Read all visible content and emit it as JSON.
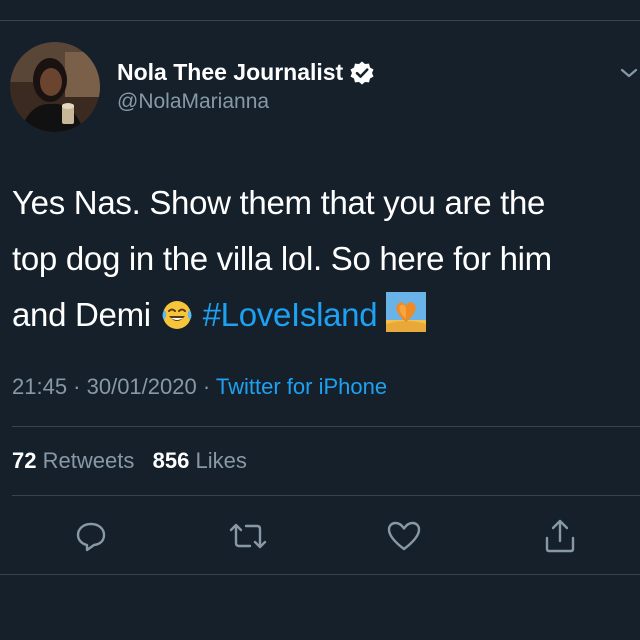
{
  "tweet": {
    "author": {
      "display_name": "Nola Thee Journalist",
      "handle": "@NolaMarianna",
      "verified": true,
      "avatar_icon": "profile-photo"
    },
    "text": {
      "line1": "Yes Nas. Show them that you are the",
      "line2": "top dog in the villa lol. So here for him",
      "line3_prefix": "and Demi",
      "emoji_1": "face-with-tears-of-joy",
      "hashtag": "#LoveIsland",
      "emoji_2": "love-island-heart-icon"
    },
    "timestamp": "21:45 · 30/01/2020",
    "separator": "·",
    "source": "Twitter for iPhone",
    "stats": {
      "retweets_count": "72",
      "retweets_label": "Retweets",
      "likes_count": "856",
      "likes_label": "Likes"
    },
    "actions": [
      "reply-icon",
      "retweet-icon",
      "like-icon",
      "share-icon"
    ]
  },
  "colors": {
    "background": "#15202b",
    "divider": "#38444d",
    "primary_text": "#ffffff",
    "secondary_text": "#8899a6",
    "accent": "#1da1f2"
  }
}
